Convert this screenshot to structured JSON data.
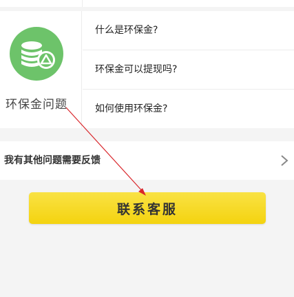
{
  "faq": {
    "category": {
      "label": "环保金问题",
      "icon": "coin-stack-recycle-icon",
      "icon_color": "#6dc36a"
    },
    "questions": [
      "什么是环保金?",
      "环保金可以提现吗?",
      "如何使用环保金?"
    ]
  },
  "feedback": {
    "label": "我有其他问题需要反馈",
    "icon": "chevron-right-icon"
  },
  "contact_button": {
    "label": "联系客服",
    "color": "#f6d82a"
  },
  "annotation": {
    "color": "#d9262b"
  }
}
